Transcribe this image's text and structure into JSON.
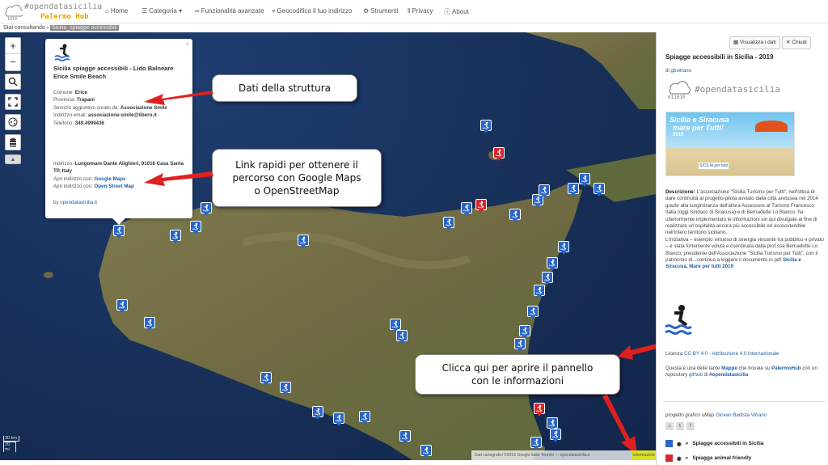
{
  "nav": {
    "logo_line1": "#opendatasicilia",
    "logo_line2": "Palermo Hub",
    "items": [
      {
        "label": "Home",
        "icon": "home-icon"
      },
      {
        "label": "Categoria",
        "icon": "list-icon"
      },
      {
        "label": "Funzionalità avanzate",
        "icon": "link-icon"
      },
      {
        "label": "Geocodifica il tuo indirizzo",
        "icon": "map-marker-icon"
      },
      {
        "label": "Strumenti",
        "icon": "gear-icon"
      },
      {
        "label": "Privacy",
        "icon": "privacy-icon"
      },
      {
        "label": "About",
        "icon": "info-icon"
      }
    ]
  },
  "breadcrumb": {
    "prefix": "Stai consultando",
    "current": "Sicilia_spiagge accessibili"
  },
  "map": {
    "scale_km": "30 km",
    "scale_mi": "20 mi",
    "attribution": "Dati cartografici ©2019 Google Italia Termini — opendatasicilia.it",
    "attribution_highlight": "Informazioni"
  },
  "popup": {
    "title": "Sicilia spiagge accessibili - Lido Balneare Erice Smile Beach",
    "comune_label": "Comune:",
    "comune": "Erice",
    "provincia_label": "Provincia:",
    "provincia": "Trapani",
    "servizio_label": "Servizio aggiuntivo curato da:",
    "servizio": "Associazione Smile",
    "email_label": "Indirizzo email:",
    "email": "associazione-smile@libero.it",
    "email_suffix": "-",
    "telefono_label": "Telefono:",
    "telefono": "349.4999436",
    "indirizzo_label": "Indirizzo:",
    "indirizzo": "Lungomare Dante Alighieri, 91016 Casa Santa TP, Italy",
    "apri_label": "Apri indirizzo con:",
    "gmaps": "Google Maps",
    "osm": "Open Street Map",
    "by_label": "by",
    "by": "opendatasicilia.it"
  },
  "callouts": {
    "dati": "Dati della struttura",
    "link_l1": "Link rapidi per ottenere il",
    "link_l2": "percorso con  Google Maps",
    "link_l3": "o OpenStreetMap",
    "clicca_l1": "Clicca qui per aprire il pannello",
    "clicca_l2": "con le informazioni"
  },
  "panel": {
    "btn_visualizza": "Visualizza i dati",
    "btn_chiudi": "Chiudi",
    "title": "Spiagge accessibili in Sicilia - 2019",
    "by_label": "di",
    "by": "gbvitrano",
    "tag": "#opendatasicilia",
    "poster_l1": "Sicilia e Siracusa",
    "poster_l2": "mare per Tutti!",
    "poster_year": "2019",
    "poster_brand": "SICILIA per tutti",
    "desc_label": "Descrizione:",
    "desc_p1": "L'associazione \"Sicilia Turismo per Tutti\", nell'ottica di dare continuità al progetto-pilota avviato dalla città aretusea nel 2014 grazie alla lungimiranza dell'allora Assessore al Turismo Francesco Italia (oggi Sindaco di Siracusa) e di Bernadette Lo Bianco, ha ulteriormente implementato le informazioni sin qui divulgate al fine di realizzare un'ospitalità ancora più accessibile ed ecosostenibile nell'intero territorio siciliano.",
    "desc_p2": "L'iniziativa – esempio virtuoso di sinergia vincente tra pubblico e privato – è stata fortemente voluta e coordinata dalla prof.ssa Bernadette Lo Bianco, presidente dell'Associazione \"Sicilia Turismo per Tutti\", con il patrocinio di...continua a leggere il documento in pdf",
    "desc_link": "Sicilia e Siracusa, Mare per tutti 2019",
    "licenza_label": "Licenza",
    "licenza": "CC BY 4.0 - Attribuzione 4.0 internazionale",
    "mappe_text1": "Questa è una delle tante",
    "mappe_link1": "Mappe",
    "mappe_text2": "che trovate su",
    "mappe_link2": "PalermoHub",
    "mappe_text3": "con un",
    "mappe_text4": "repository",
    "mappe_link3": "github",
    "mappe_text5": "di",
    "mappe_link4": "#opendatasicilia",
    "progetto_label": "progetto grafico uMap",
    "progetto_author": "Giovan Battista Vitrano",
    "layer1": "Spiagge accessibili in Sicilia",
    "layer2": "Spiagge animal friendly"
  },
  "colors": {
    "pin_blue": "#2a66c8",
    "pin_red": "#d3282e",
    "sea": "#172f57",
    "panel_link": "#1f5fa0"
  }
}
